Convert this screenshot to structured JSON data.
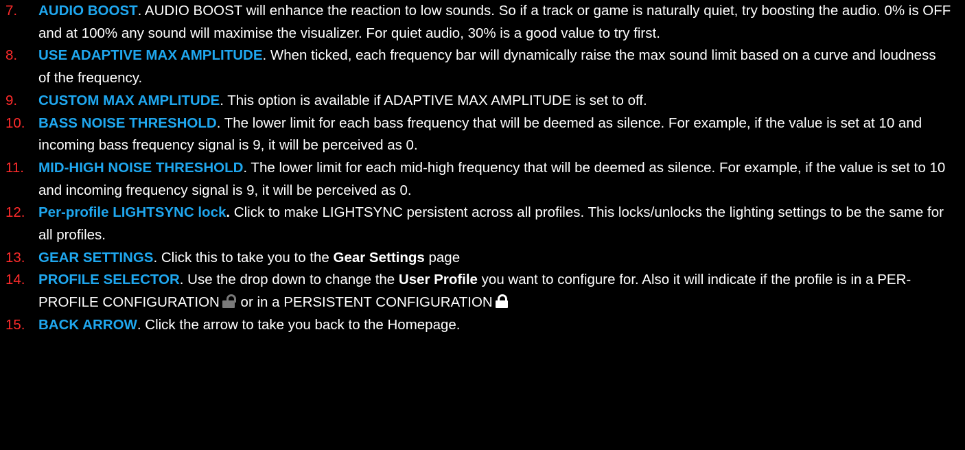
{
  "colors": {
    "background": "#000000",
    "number": "#ff2b2b",
    "title": "#1fa7ef",
    "text": "#ffffff",
    "lock_open": "#7a7a7a",
    "lock_closed": "#ffffff"
  },
  "items": [
    {
      "num": "7.",
      "title": "AUDIO BOOST",
      "desc": ".  AUDIO BOOST will enhance the reaction to low sounds.  So if a track or game is naturally quiet, try boosting the audio.  0% is OFF and at 100% any sound will maximise the visualizer.  For quiet audio, 30% is a good value to try first."
    },
    {
      "num": "8.",
      "title": "USE ADAPTIVE MAX AMPLITUDE",
      "desc": ".   When ticked, each frequency bar will dynamically raise the max sound limit based on a curve and loudness of the frequency."
    },
    {
      "num": "9.",
      "title": "CUSTOM MAX AMPLITUDE",
      "desc": ".  This option is available if ADAPTIVE MAX AMPLITUDE is set to off."
    },
    {
      "num": "10.",
      "title": "BASS NOISE THRESHOLD",
      "desc": ".  The lower limit for each bass frequency that will be deemed as silence. For example, if the value is set at 10 and incoming bass frequency signal is 9, it will be perceived as 0."
    },
    {
      "num": "11.",
      "title": "MID-HIGH NOISE THRESHOLD",
      "desc": ".  The lower limit for each mid-high frequency that will be deemed as silence.  For example, if the value is set to 10 and incoming frequency signal is 9, it will be perceived as 0."
    },
    {
      "num": "12.",
      "title": "Per-profile LIGHTSYNC lock",
      "title_dot": ".",
      "desc": "  Click to make LIGHTSYNC persistent across all profiles.  This locks/unlocks the lighting settings to be the same for all profiles."
    },
    {
      "num": "13.",
      "title": "GEAR SETTINGS",
      "desc": ".  Click this to take you to the ",
      "bold": "Gear Settings",
      "desc_after": " page"
    },
    {
      "num": "14.",
      "title": "PROFILE SELECTOR",
      "desc": ".  Use the drop down to change the ",
      "bold": "User Profile",
      "desc_after": " you want to configure for. Also it will indicate if the profile is in a PER-PROFILE CONFIGURATION",
      "desc_mid": " or in a PERSISTENT CONFIGURATION",
      "icon_open": "unlocked-padlock-icon",
      "icon_closed": "locked-padlock-icon"
    },
    {
      "num": "15.",
      "title": "BACK ARROW",
      "desc": ".  Click the arrow to take you back to the Homepage."
    }
  ]
}
